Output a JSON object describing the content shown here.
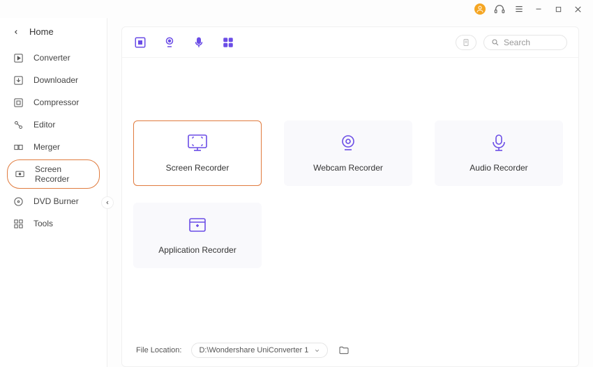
{
  "titlebar": {},
  "sidebar": {
    "home_label": "Home",
    "items": [
      {
        "label": "Converter"
      },
      {
        "label": "Downloader"
      },
      {
        "label": "Compressor"
      },
      {
        "label": "Editor"
      },
      {
        "label": "Merger"
      },
      {
        "label": "Screen Recorder"
      },
      {
        "label": "DVD Burner"
      },
      {
        "label": "Tools"
      }
    ]
  },
  "toolbar": {
    "search_placeholder": "Search"
  },
  "cards": [
    {
      "label": "Screen Recorder"
    },
    {
      "label": "Webcam Recorder"
    },
    {
      "label": "Audio Recorder"
    },
    {
      "label": "Application Recorder"
    }
  ],
  "bottom": {
    "file_location_label": "File Location:",
    "file_location_value": "D:\\Wondershare UniConverter 1"
  }
}
